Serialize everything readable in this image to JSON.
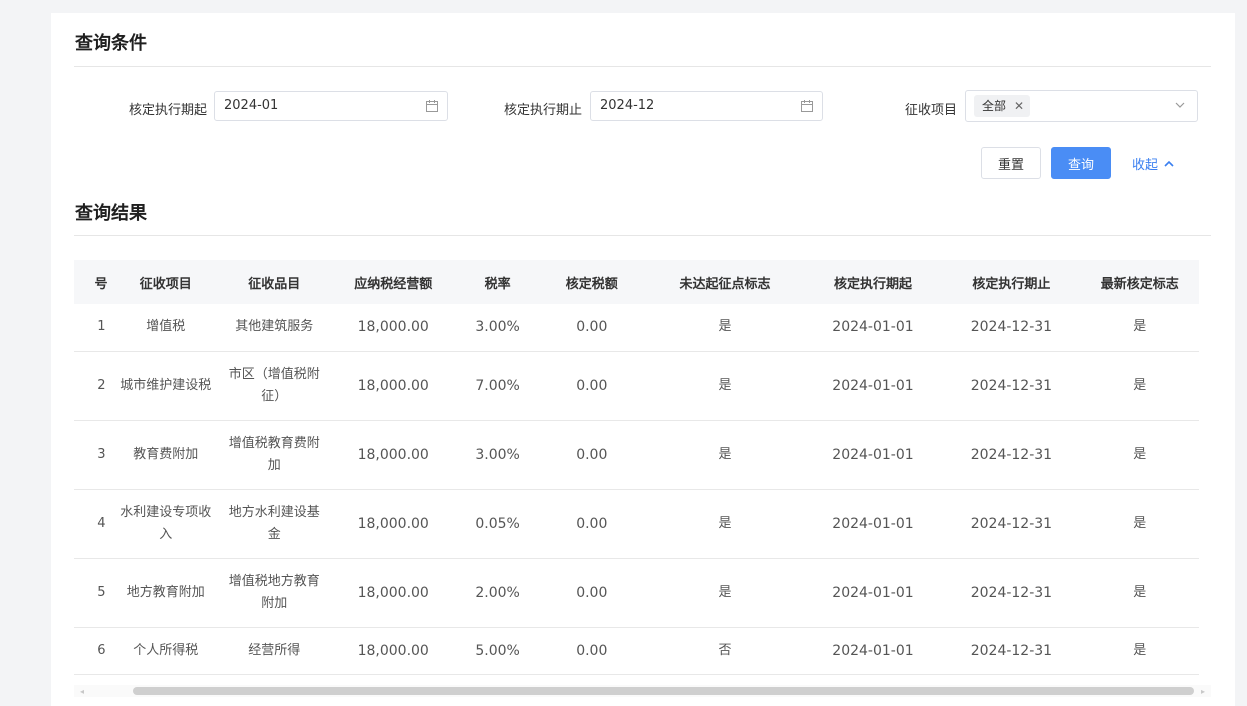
{
  "query": {
    "title": "查询条件",
    "start_label": "核定执行期起",
    "start_value": "2024-01",
    "end_label": "核定执行期止",
    "end_value": "2024-12",
    "item_label": "征收项目",
    "item_tag": "全部",
    "reset_label": "重置",
    "query_label": "查询",
    "collapse_label": "收起"
  },
  "results": {
    "title": "查询结果",
    "columns": [
      "号",
      "征收项目",
      "征收品目",
      "应纳税经营额",
      "税率",
      "核定税额",
      "未达起征点标志",
      "核定执行期起",
      "核定执行期止",
      "最新核定标志"
    ],
    "rows": [
      {
        "no": "1",
        "item": "增值税",
        "sub": "其他建筑服务",
        "amount": "18,000.00",
        "rate": "3.00%",
        "tax": "0.00",
        "flag": "是",
        "start": "2024-01-01",
        "end": "2024-12-31",
        "latest": "是"
      },
      {
        "no": "2",
        "item": "城市维护建设税",
        "sub": "市区（增值税附征）",
        "amount": "18,000.00",
        "rate": "7.00%",
        "tax": "0.00",
        "flag": "是",
        "start": "2024-01-01",
        "end": "2024-12-31",
        "latest": "是"
      },
      {
        "no": "3",
        "item": "教育费附加",
        "sub": "增值税教育费附加",
        "amount": "18,000.00",
        "rate": "3.00%",
        "tax": "0.00",
        "flag": "是",
        "start": "2024-01-01",
        "end": "2024-12-31",
        "latest": "是"
      },
      {
        "no": "4",
        "item": "水利建设专项收入",
        "sub": "地方水利建设基金",
        "amount": "18,000.00",
        "rate": "0.05%",
        "tax": "0.00",
        "flag": "是",
        "start": "2024-01-01",
        "end": "2024-12-31",
        "latest": "是"
      },
      {
        "no": "5",
        "item": "地方教育附加",
        "sub": "增值税地方教育附加",
        "amount": "18,000.00",
        "rate": "2.00%",
        "tax": "0.00",
        "flag": "是",
        "start": "2024-01-01",
        "end": "2024-12-31",
        "latest": "是"
      },
      {
        "no": "6",
        "item": "个人所得税",
        "sub": "经营所得",
        "amount": "18,000.00",
        "rate": "5.00%",
        "tax": "0.00",
        "flag": "否",
        "start": "2024-01-01",
        "end": "2024-12-31",
        "latest": "是"
      }
    ]
  },
  "colors": {
    "primary": "#4a8df5",
    "link": "#3a7ff0",
    "header_bg": "#f6f7f9"
  }
}
